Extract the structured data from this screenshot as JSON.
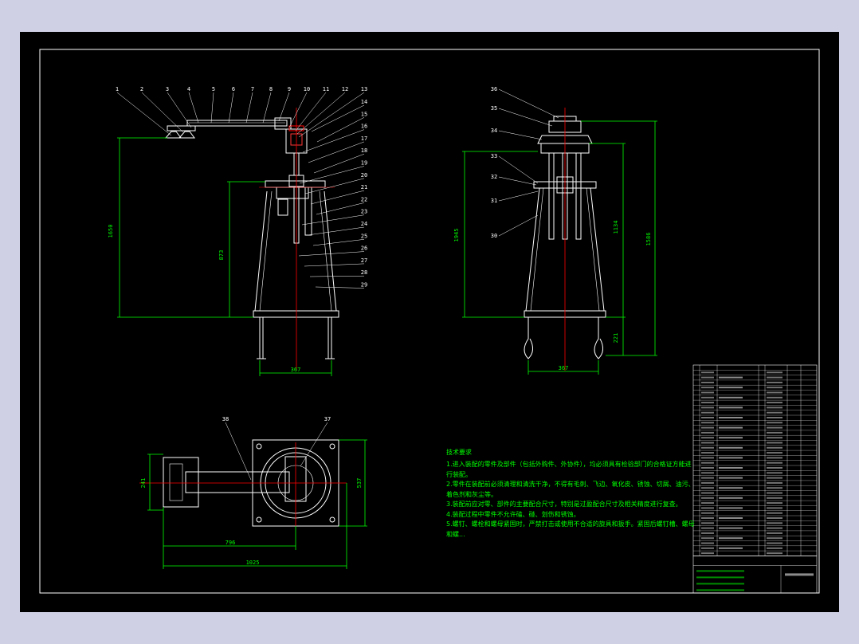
{
  "colors": {
    "outer_bg": "#cfd0e4",
    "canvas": "#000000",
    "drawing": "#ffffff",
    "dimension": "#00ff00",
    "centerline": "#ff0000",
    "leader": "#ffffff"
  },
  "front_view": {
    "part_labels": [
      "1",
      "2",
      "3",
      "4",
      "5",
      "6",
      "7",
      "8",
      "9",
      "10",
      "11",
      "12",
      "13",
      "14",
      "15",
      "16",
      "17",
      "18",
      "19",
      "20",
      "21",
      "22",
      "23",
      "24",
      "25",
      "26",
      "27",
      "28",
      "29"
    ],
    "dims": {
      "overall_height": "1650",
      "lower_height": "873",
      "base_width": "367"
    }
  },
  "side_view": {
    "part_labels": [
      "36",
      "35",
      "34",
      "33",
      "32",
      "31",
      "30"
    ],
    "dims": {
      "left_height": "1945",
      "mid_height": "1134",
      "right_height": "1586",
      "bottom_height": "221",
      "base_width": "367"
    }
  },
  "top_view": {
    "part_labels": [
      "38",
      "37"
    ],
    "dims": {
      "left_width": "241",
      "right_width": "537",
      "arm_length": "796",
      "overall_length": "1025"
    }
  },
  "notes": {
    "title": "技术要求",
    "lines": [
      "1.进入装配的零件及部件（包括外购件、外协件），均必须具有检验部门的合格证方能进",
      "行装配。",
      "2.零件在装配前必须清理和清洗干净，不得有毛刺、飞边、氧化皮、锈蚀、切屑、油污、",
      "着色剂和灰尘等。",
      "3.装配前应对零、部件的主要配合尺寸，特别是过盈配合尺寸及相关精度进行复查。",
      "4.装配过程中零件不允许磕、碰、划伤和锈蚀。",
      "5.螺钉、螺栓和螺母紧固时，严禁打击或使用不合适的旋具和扳手。紧固后螺钉槽、螺母",
      "和螺..."
    ]
  }
}
